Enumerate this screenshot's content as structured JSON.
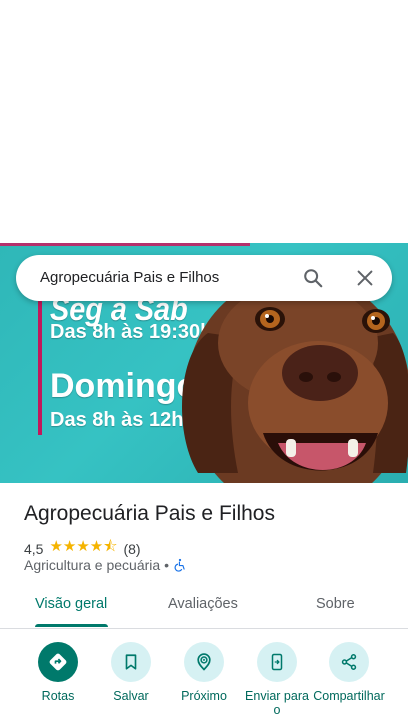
{
  "search": {
    "query": "Agropecuária Pais e Filhos"
  },
  "hero": {
    "promo_line1": "Seg à Sab",
    "promo_line2": "Das 8h às 19:30h",
    "promo_line3": "Domingo",
    "promo_line4": "Das 8h às 12h"
  },
  "place": {
    "name": "Agropecuária Pais e Filhos",
    "rating": "4,5",
    "stars": "★★★★⯪",
    "review_count": "(8)",
    "category": "Agricultura e pecuária •"
  },
  "tabs": [
    {
      "label": "Visão geral",
      "active": true
    },
    {
      "label": "Avaliações",
      "active": false
    },
    {
      "label": "Sobre",
      "active": false
    }
  ],
  "actions": [
    {
      "label": "Rotas",
      "icon": "directions-icon"
    },
    {
      "label": "Salvar",
      "icon": "bookmark-icon"
    },
    {
      "label": "Próximo",
      "icon": "nearby-icon"
    },
    {
      "label": "Enviar para o",
      "icon": "send-to-phone-icon"
    },
    {
      "label": "Compartilhar",
      "icon": "share-icon"
    }
  ],
  "colors": {
    "accent": "#00796b",
    "action_bg": "#d6f1f3",
    "star": "#f5b400",
    "hero_bg": "#36c2c3"
  }
}
